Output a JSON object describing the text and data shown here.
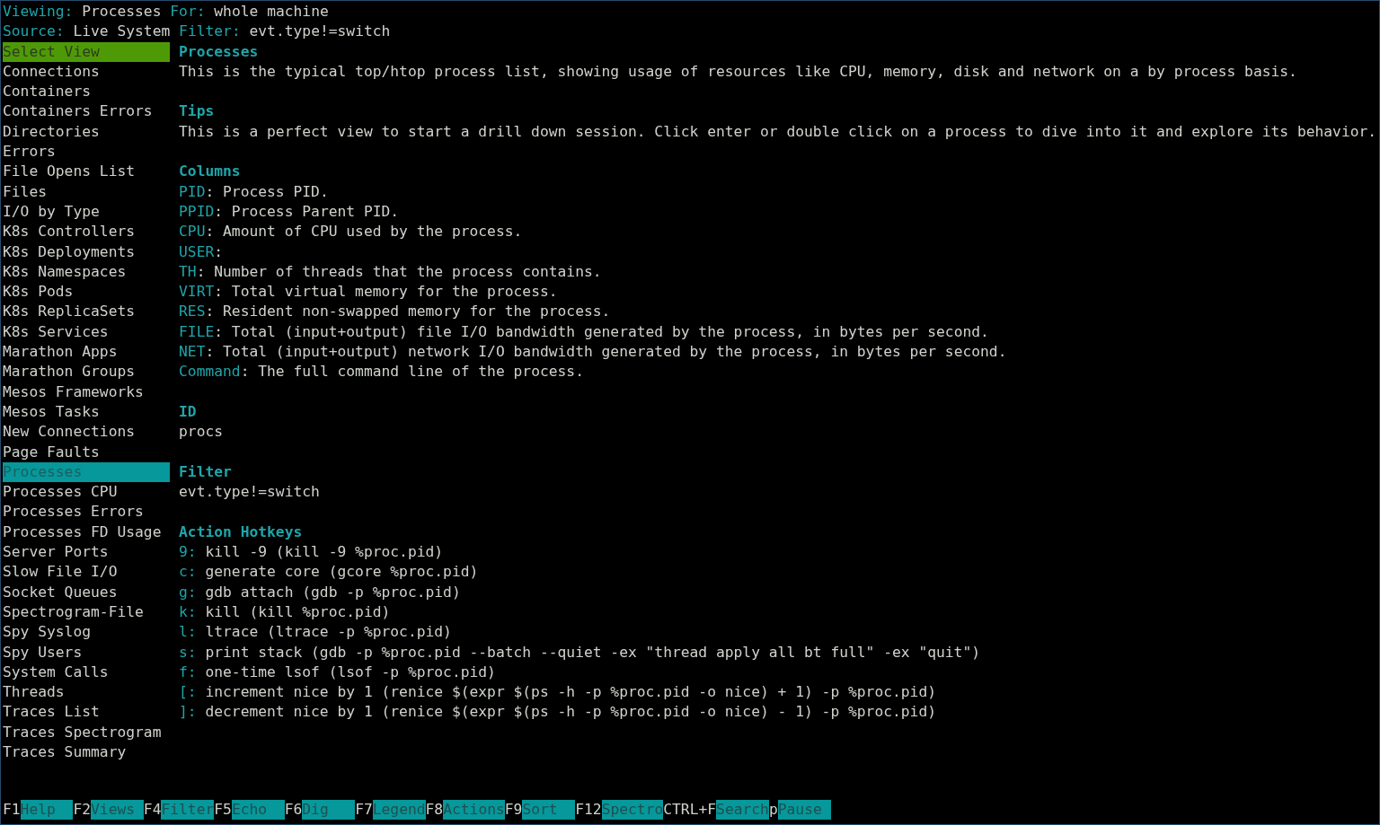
{
  "header": [
    {
      "pairs": [
        {
          "label": "Viewing:",
          "value": "Processes"
        },
        {
          "label": "For:",
          "value": "whole machine"
        }
      ]
    },
    {
      "pairs": [
        {
          "label": "Source:",
          "value": "Live System"
        },
        {
          "label": "Filter:",
          "value": "evt.type!=switch"
        }
      ]
    }
  ],
  "sidebar": {
    "title": "Select View",
    "items": [
      {
        "label": "Connections",
        "selected": false
      },
      {
        "label": "Containers",
        "selected": false
      },
      {
        "label": "Containers Errors",
        "selected": false
      },
      {
        "label": "Directories",
        "selected": false
      },
      {
        "label": "Errors",
        "selected": false
      },
      {
        "label": "File Opens List",
        "selected": false
      },
      {
        "label": "Files",
        "selected": false
      },
      {
        "label": "I/O by Type",
        "selected": false
      },
      {
        "label": "K8s Controllers",
        "selected": false
      },
      {
        "label": "K8s Deployments",
        "selected": false
      },
      {
        "label": "K8s Namespaces",
        "selected": false
      },
      {
        "label": "K8s Pods",
        "selected": false
      },
      {
        "label": "K8s ReplicaSets",
        "selected": false
      },
      {
        "label": "K8s Services",
        "selected": false
      },
      {
        "label": "Marathon Apps",
        "selected": false
      },
      {
        "label": "Marathon Groups",
        "selected": false
      },
      {
        "label": "Mesos Frameworks",
        "selected": false
      },
      {
        "label": "Mesos Tasks",
        "selected": false
      },
      {
        "label": "New Connections",
        "selected": false
      },
      {
        "label": "Page Faults",
        "selected": false
      },
      {
        "label": "Processes",
        "selected": true
      },
      {
        "label": "Processes CPU",
        "selected": false
      },
      {
        "label": "Processes Errors",
        "selected": false
      },
      {
        "label": "Processes FD Usage",
        "selected": false
      },
      {
        "label": "Server Ports",
        "selected": false
      },
      {
        "label": "Slow File I/O",
        "selected": false
      },
      {
        "label": "Socket Queues",
        "selected": false
      },
      {
        "label": "Spectrogram-File",
        "selected": false
      },
      {
        "label": "Spy Syslog",
        "selected": false
      },
      {
        "label": "Spy Users",
        "selected": false
      },
      {
        "label": "System Calls",
        "selected": false
      },
      {
        "label": "Threads",
        "selected": false
      },
      {
        "label": "Traces List",
        "selected": false
      },
      {
        "label": "Traces Spectrogram",
        "selected": false
      },
      {
        "label": "Traces Summary",
        "selected": false
      }
    ]
  },
  "info": [
    {
      "heading": "Processes",
      "lines": [
        {
          "text": "This is the typical top/htop process list, showing usage of resources like CPU, memory, disk and network on a by process basis."
        }
      ]
    },
    {
      "heading": "Tips",
      "lines": [
        {
          "text": "This is a perfect view to start a drill down session. Click enter or double click on a process to dive into it and explore its behavior."
        }
      ]
    },
    {
      "heading": "Columns",
      "lines": [
        {
          "key": "PID",
          "text": ": Process PID."
        },
        {
          "key": "PPID",
          "text": ": Process Parent PID."
        },
        {
          "key": "CPU",
          "text": ": Amount of CPU used by the process."
        },
        {
          "key": "USER",
          "text": ":"
        },
        {
          "key": "TH",
          "text": ": Number of threads that the process contains."
        },
        {
          "key": "VIRT",
          "text": ": Total virtual memory for the process."
        },
        {
          "key": "RES",
          "text": ": Resident non-swapped memory for the process."
        },
        {
          "key": "FILE",
          "text": ": Total (input+output) file I/O bandwidth generated by the process, in bytes per second."
        },
        {
          "key": "NET",
          "text": ": Total (input+output) network I/O bandwidth generated by the process, in bytes per second."
        },
        {
          "key": "Command",
          "text": ": The full command line of the process."
        }
      ]
    },
    {
      "heading": "ID",
      "lines": [
        {
          "text": "procs"
        }
      ]
    },
    {
      "heading": "Filter",
      "lines": [
        {
          "text": "evt.type!=switch"
        }
      ]
    },
    {
      "heading": "Action Hotkeys",
      "lines": [
        {
          "key": "9:",
          "text": " kill -9 (kill -9 %proc.pid)"
        },
        {
          "key": "c:",
          "text": " generate core (gcore %proc.pid)"
        },
        {
          "key": "g:",
          "text": " gdb attach (gdb -p %proc.pid)"
        },
        {
          "key": "k:",
          "text": " kill (kill %proc.pid)"
        },
        {
          "key": "l:",
          "text": " ltrace (ltrace -p %proc.pid)"
        },
        {
          "key": "s:",
          "text": " print stack (gdb -p %proc.pid --batch --quiet -ex \"thread apply all bt full\" -ex \"quit\")"
        },
        {
          "key": "f:",
          "text": " one-time lsof (lsof -p %proc.pid)"
        },
        {
          "key": "[:",
          "text": " increment nice by 1 (renice $(expr $(ps -h -p %proc.pid -o nice) + 1) -p %proc.pid)"
        },
        {
          "key": "]:",
          "text": " decrement nice by 1 (renice $(expr $(ps -h -p %proc.pid -o nice) - 1) -p %proc.pid)"
        }
      ]
    }
  ],
  "hotkeys": [
    {
      "key": "F1",
      "label": "Help"
    },
    {
      "key": "F2",
      "label": "Views"
    },
    {
      "key": "F4",
      "label": "Filter"
    },
    {
      "key": "F5",
      "label": "Echo"
    },
    {
      "key": "F6",
      "label": "Dig"
    },
    {
      "key": "F7",
      "label": "Legend"
    },
    {
      "key": "F8",
      "label": "Actions"
    },
    {
      "key": "F9",
      "label": "Sort"
    },
    {
      "key": "F12",
      "label": "Spectro"
    },
    {
      "key": "CTRL+F",
      "label": "Search"
    },
    {
      "key": "p",
      "label": "Pause"
    }
  ]
}
